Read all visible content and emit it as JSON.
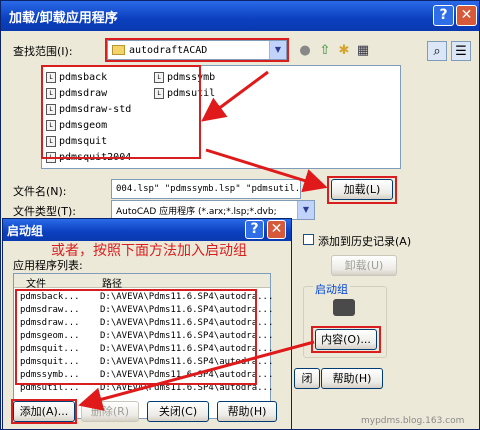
{
  "main_dialog": {
    "title": "加载/卸载应用程序",
    "help_glyph": "?",
    "close_glyph": "✕",
    "look_in_label": "查找范围(I):",
    "look_in_value": "autodraftACAD",
    "files": [
      "pdmsback",
      "pdmsdraw",
      "pdmsdraw-std",
      "pdmsgeom",
      "pdmsquit",
      "pdmsquit2004",
      "pdmssymb",
      "pdmsutil"
    ],
    "file_name_label": "文件名(N):",
    "file_name_value": "004.lsp\" \"pdmssymb.lsp\" \"pdmsutil.lsp",
    "file_type_label": "文件类型(T):",
    "file_type_value": "AutoCAD 应用程序 (*.arx;*.lsp;*.dvb;",
    "load_button": "加载(L)",
    "add_history_label": "添加到历史记录(A)",
    "unload_button": "卸载(U)",
    "startup_suite_group": "启动组",
    "contents_button": "内容(O)...",
    "close_button_bottom": "闭",
    "help_button_bottom": "帮助(H)"
  },
  "startup_suite": {
    "title": "启动组",
    "close_glyph": "✕",
    "help_glyph": "?",
    "annotation": "或者，按照下面方法加入启动组",
    "list_label": "应用程序列表:",
    "col_file": "文件",
    "col_path": "路径",
    "rows": [
      {
        "file": "pdmsback...",
        "path": "D:\\AVEVA\\Pdms11.6.SP4\\autodra..."
      },
      {
        "file": "pdmsdraw...",
        "path": "D:\\AVEVA\\Pdms11.6.SP4\\autodra..."
      },
      {
        "file": "pdmsdraw...",
        "path": "D:\\AVEVA\\Pdms11.6.SP4\\autodra..."
      },
      {
        "file": "pdmsgeom...",
        "path": "D:\\AVEVA\\Pdms11.6.SP4\\autodra..."
      },
      {
        "file": "pdmsquit...",
        "path": "D:\\AVEVA\\Pdms11.6.SP4\\autodra..."
      },
      {
        "file": "pdmsquit...",
        "path": "D:\\AVEVA\\Pdms11.6.SP4\\autodra..."
      },
      {
        "file": "pdmssymb...",
        "path": "D:\\AVEVA\\Pdms11.6.SP4\\autodra..."
      },
      {
        "file": "pdmsutil...",
        "path": "D:\\AVEVA\\Pdms11.6.SP4\\autodra..."
      }
    ],
    "add_button": "添加(A)...",
    "remove_button": "删除(R)",
    "close_button": "关闭(C)",
    "help_button": "帮助(H)"
  },
  "watermark": "mypdms.blog.163.com",
  "colors": {
    "annotation_red": "#d81e1e",
    "title_blue": "#0b3fbf"
  }
}
